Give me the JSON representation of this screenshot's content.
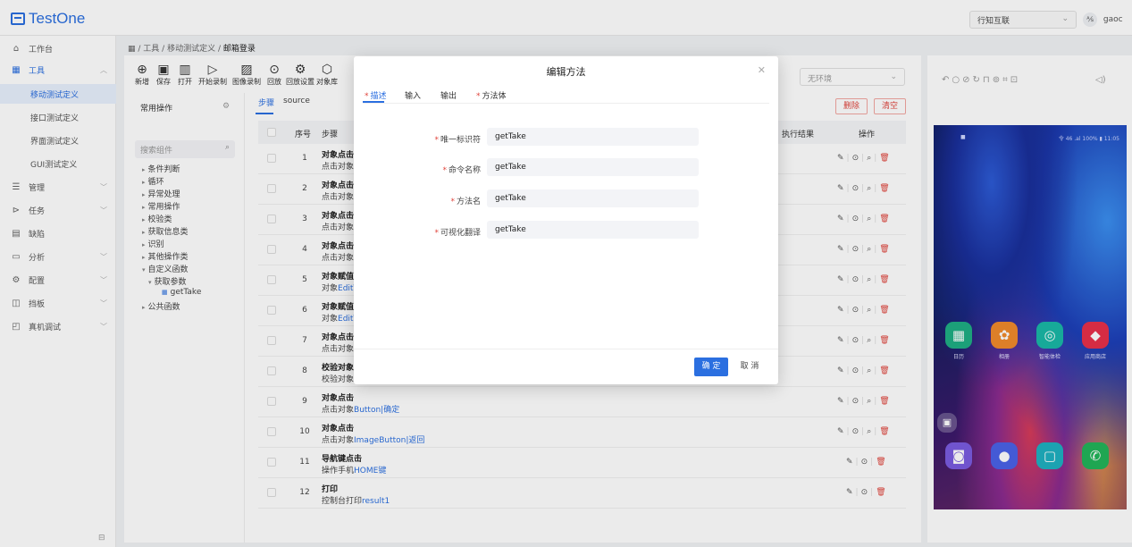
{
  "app": {
    "name": "TestOne"
  },
  "topbar": {
    "org": "行知互联",
    "user": "gaoc",
    "user_badge": "⅍"
  },
  "sidebar": {
    "items": [
      {
        "label": "工作台",
        "icon": "home-icon"
      },
      {
        "label": "工具",
        "icon": "grid-icon"
      },
      {
        "label": "管理",
        "icon": "list-icon"
      },
      {
        "label": "任务",
        "icon": "send-icon"
      },
      {
        "label": "缺陷",
        "icon": "doc-icon"
      },
      {
        "label": "分析",
        "icon": "chart-icon"
      },
      {
        "label": "配置",
        "icon": "gear-icon"
      },
      {
        "label": "挡板",
        "icon": "panel-icon"
      },
      {
        "label": "真机调试",
        "icon": "device-icon"
      }
    ],
    "tool_children": [
      "移动测试定义",
      "接口测试定义",
      "界面测试定义",
      "GUI测试定义"
    ]
  },
  "breadcrumb": {
    "root": "工具",
    "mid": "移动测试定义",
    "current": "邮箱登录"
  },
  "toolbar": [
    "新增",
    "保存",
    "打开",
    "开始录制",
    "图像录制",
    "回放",
    "回放设置",
    "对象库"
  ],
  "panel": {
    "title": "常用操作",
    "search_placeholder": "搜索组件",
    "tree": [
      "条件判断",
      "循环",
      "异常处理",
      "常用操作",
      "校验类",
      "获取信息类",
      "识别",
      "其他操作类",
      "自定义函数",
      "获取参数",
      "getTake",
      "公共函数"
    ]
  },
  "tabs": [
    "步骤",
    "source"
  ],
  "grid": {
    "headers": {
      "no": "序号",
      "step": "步骤",
      "result": "执行结果",
      "ops": "操作"
    },
    "rows": [
      {
        "no": "1",
        "t1": "对象点击",
        "t2a": "点击对象",
        "t2b": ""
      },
      {
        "no": "2",
        "t1": "对象点击",
        "t2a": "点击对象",
        "t2b": ""
      },
      {
        "no": "3",
        "t1": "对象点击",
        "t2a": "点击对象",
        "t2b": ""
      },
      {
        "no": "4",
        "t1": "对象点击",
        "t2a": "点击对象",
        "t2b": ""
      },
      {
        "no": "5",
        "t1": "对象赋值",
        "t2a": "对象",
        "t2b": "EditT"
      },
      {
        "no": "6",
        "t1": "对象赋值",
        "t2a": "对象",
        "t2b": "EditT"
      },
      {
        "no": "7",
        "t1": "对象点击",
        "t2a": "点击对象",
        "t2b": ""
      },
      {
        "no": "8",
        "t1": "校验对象",
        "t2a": "校验对象",
        "t2b": ""
      },
      {
        "no": "9",
        "t1": "对象点击",
        "t2a": "点击对象",
        "t2b": "Button|确定"
      },
      {
        "no": "10",
        "t1": "对象点击",
        "t2a": "点击对象",
        "t2b": "ImageButton|返回"
      },
      {
        "no": "11",
        "t1": "导航键点击",
        "t2a": "操作手机",
        "t2b": "HOME键"
      },
      {
        "no": "12",
        "t1": "打印",
        "t2a": "控制台打印",
        "t2b": "result1"
      }
    ]
  },
  "env": {
    "placeholder": "无环境"
  },
  "actions": {
    "delete": "删除",
    "clear": "清空"
  },
  "device": {
    "status_right": "令 46 .al 100% ▮ 11:05",
    "apps": [
      "日历",
      "相册",
      "智能体检",
      "应用商店"
    ]
  },
  "modal": {
    "title": "编辑方法",
    "tabs": [
      "描述",
      "输入",
      "输出",
      "方法体"
    ],
    "fields": [
      {
        "label": "唯一标识符",
        "value": "getTake"
      },
      {
        "label": "命令名称",
        "value": "getTake"
      },
      {
        "label": "方法名",
        "value": "getTake"
      },
      {
        "label": "可视化翻译",
        "value": "getTake"
      }
    ],
    "ok": "确 定",
    "cancel": "取 消"
  },
  "colors": {
    "primary": "#2b6fe0",
    "danger": "#e0443c"
  }
}
